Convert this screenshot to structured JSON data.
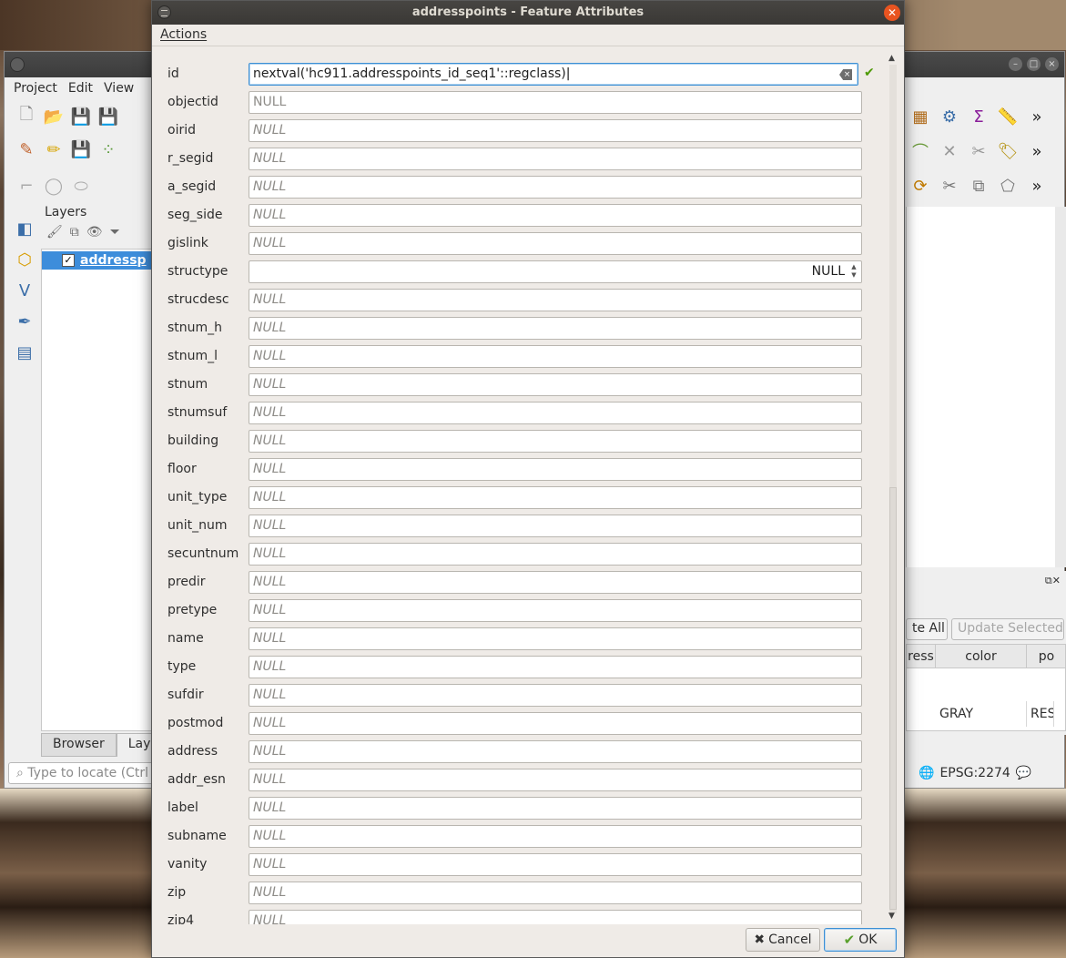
{
  "background_window": {
    "menu": [
      "Project",
      "Edit",
      "View"
    ],
    "layers_panel": {
      "title": "Layers",
      "layer_name": "addressp",
      "tabs": [
        "Browser",
        "Laye"
      ]
    },
    "locate_placeholder": "Type to locate (Ctrl",
    "attribute_table": {
      "buttons": [
        "te All",
        "Update Selected"
      ],
      "columns": [
        "ress",
        "color",
        "po"
      ],
      "row_values": [
        "GRAY",
        "RES"
      ]
    },
    "statusbar": {
      "crs": "EPSG:2274"
    }
  },
  "dialog": {
    "title": "addresspoints - Feature Attributes",
    "menu_actions": "Actions",
    "fields": [
      {
        "label": "id",
        "value": "nextval('hc911.addresspoints_id_seq1'::regclass)",
        "kind": "active"
      },
      {
        "label": "objectid",
        "value": "NULL",
        "kind": "plain"
      },
      {
        "label": "oirid",
        "value": "NULL",
        "kind": "null"
      },
      {
        "label": "r_segid",
        "value": "NULL",
        "kind": "null"
      },
      {
        "label": "a_segid",
        "value": "NULL",
        "kind": "null"
      },
      {
        "label": "seg_side",
        "value": "NULL",
        "kind": "null"
      },
      {
        "label": "gislink",
        "value": "NULL",
        "kind": "null"
      },
      {
        "label": "structype",
        "value": "NULL",
        "kind": "spin"
      },
      {
        "label": "strucdesc",
        "value": "NULL",
        "kind": "null"
      },
      {
        "label": "stnum_h",
        "value": "NULL",
        "kind": "null"
      },
      {
        "label": "stnum_l",
        "value": "NULL",
        "kind": "null"
      },
      {
        "label": "stnum",
        "value": "NULL",
        "kind": "null"
      },
      {
        "label": "stnumsuf",
        "value": "NULL",
        "kind": "null"
      },
      {
        "label": "building",
        "value": "NULL",
        "kind": "null"
      },
      {
        "label": "floor",
        "value": "NULL",
        "kind": "null"
      },
      {
        "label": "unit_type",
        "value": "NULL",
        "kind": "null"
      },
      {
        "label": "unit_num",
        "value": "NULL",
        "kind": "null"
      },
      {
        "label": "secuntnum",
        "value": "NULL",
        "kind": "null"
      },
      {
        "label": "predir",
        "value": "NULL",
        "kind": "null"
      },
      {
        "label": "pretype",
        "value": "NULL",
        "kind": "null"
      },
      {
        "label": "name",
        "value": "NULL",
        "kind": "null"
      },
      {
        "label": "type",
        "value": "NULL",
        "kind": "null"
      },
      {
        "label": "sufdir",
        "value": "NULL",
        "kind": "null"
      },
      {
        "label": "postmod",
        "value": "NULL",
        "kind": "null"
      },
      {
        "label": "address",
        "value": "NULL",
        "kind": "null"
      },
      {
        "label": "addr_esn",
        "value": "NULL",
        "kind": "null"
      },
      {
        "label": "label",
        "value": "NULL",
        "kind": "null"
      },
      {
        "label": "subname",
        "value": "NULL",
        "kind": "null"
      },
      {
        "label": "vanity",
        "value": "NULL",
        "kind": "null"
      },
      {
        "label": "zip",
        "value": "NULL",
        "kind": "null"
      },
      {
        "label": "zip4",
        "value": "NULL",
        "kind": "null"
      }
    ],
    "buttons": {
      "cancel": "Cancel",
      "ok": "OK"
    },
    "colors": {
      "accent": "#3c8fd4",
      "close": "#e95420",
      "valid": "#4e9a06"
    }
  }
}
